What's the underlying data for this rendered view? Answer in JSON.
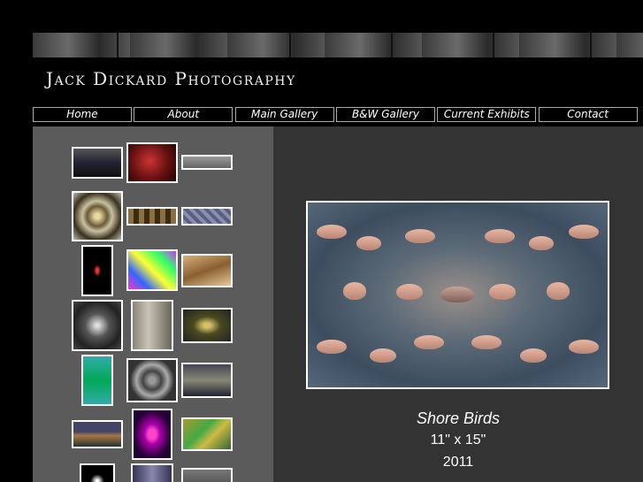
{
  "site": {
    "title": "Jack Dickard Photography"
  },
  "nav": {
    "items": [
      "Home",
      "About",
      "Main Gallery",
      "B&W Gallery",
      "Current Exhibits",
      "Contact"
    ]
  },
  "featured": {
    "title": "Shore Birds",
    "size": "11\" x 15\"",
    "year": "2011"
  },
  "colors": {
    "page_bg": "#000000",
    "sidebar_bg": "#5b5b5b",
    "main_bg": "#333333",
    "nav_border": "#aaaaaa"
  }
}
